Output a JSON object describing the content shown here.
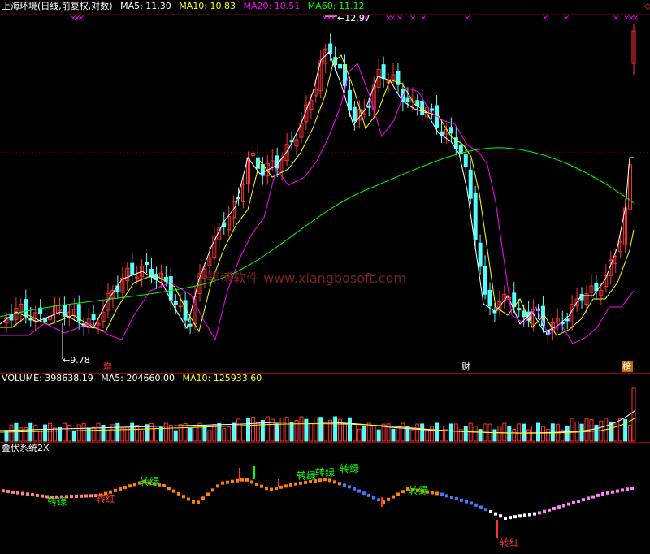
{
  "chart_data": [
    {
      "type": "candlestick",
      "name": "上海环境(日线,前复权,对数)",
      "indicators": [
        {
          "label": "MA5",
          "value": "11.30",
          "color": "#ffffff"
        },
        {
          "label": "MA10",
          "value": "10.83",
          "color": "#ffff00"
        },
        {
          "label": "MA20",
          "value": "10.51",
          "color": "#ff00ff"
        },
        {
          "label": "MA60",
          "value": "11.12",
          "color": "#00ff00"
        }
      ],
      "annotations": {
        "high": "12.97",
        "low": "9.78"
      },
      "markers": [
        "增",
        "财",
        "榜"
      ],
      "watermark": "翔博软件 www.xiangbosoft.com",
      "colors": {
        "up": "#ff3232",
        "down": "#54ffff"
      }
    },
    {
      "type": "bar",
      "name": "VOLUME",
      "indicators": [
        {
          "label": "VOLUME",
          "value": "398638.19",
          "color": "#ffffff"
        },
        {
          "label": "MA5",
          "value": "204660.00",
          "color": "#ffffff"
        },
        {
          "label": "MA10",
          "value": "125933.60",
          "color": "#ffff00"
        }
      ]
    },
    {
      "type": "line",
      "name": "叠伏系统2X",
      "signals": [
        {
          "label": "转绿",
          "color": "#00ff00"
        },
        {
          "label": "转红",
          "color": "#ff3232"
        },
        {
          "label": "转绿",
          "color": "#00ff00"
        },
        {
          "label": "转绿",
          "color": "#00ff00"
        },
        {
          "label": "转绿",
          "color": "#00ff00"
        },
        {
          "label": "转绿",
          "color": "#00ff00"
        },
        {
          "label": "转绿",
          "color": "#00ff00"
        },
        {
          "label": "转红",
          "color": "#ff3232"
        }
      ]
    }
  ]
}
